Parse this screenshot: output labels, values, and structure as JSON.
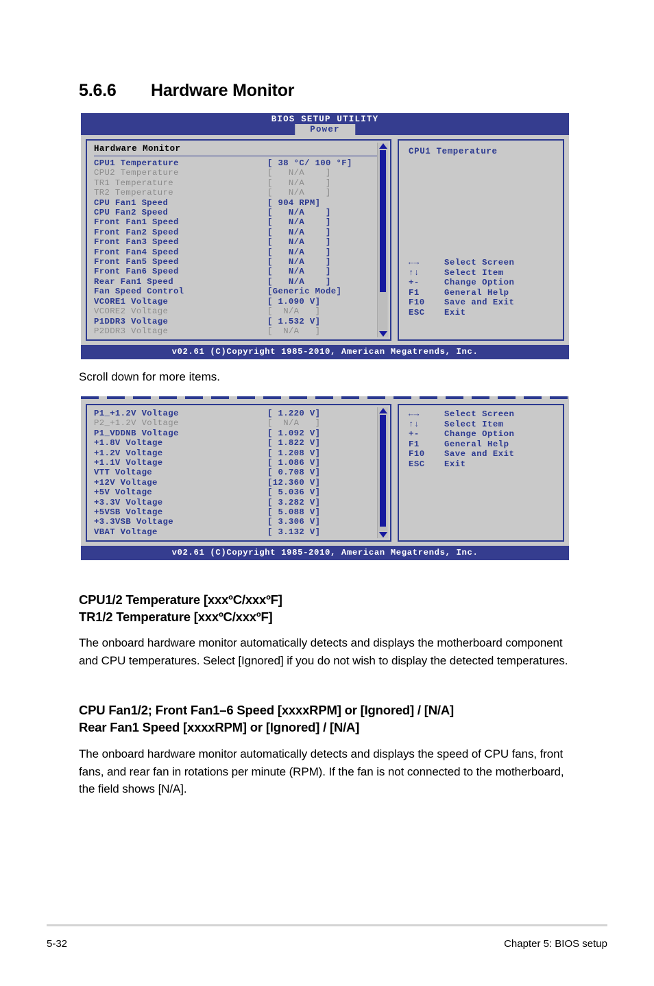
{
  "section": {
    "number": "5.6.6",
    "title": "Hardware Monitor"
  },
  "bios": {
    "utility_title": "BIOS SETUP UTILITY",
    "active_tab": "Power",
    "footer": "v02.61 (C)Copyright 1985-2010, American Megatrends, Inc.",
    "help_keys": [
      {
        "key": "←→",
        "action": "Select Screen"
      },
      {
        "key": "↑↓",
        "action": "Select Item"
      },
      {
        "key": "+-",
        "action": "Change Option"
      },
      {
        "key": "F1",
        "action": "General Help"
      },
      {
        "key": "F10",
        "action": "Save and Exit"
      },
      {
        "key": "ESC",
        "action": "Exit"
      }
    ]
  },
  "screen1": {
    "group_title": "Hardware Monitor",
    "help_item": "CPU1 Temperature",
    "items": [
      {
        "label": "CPU1 Temperature",
        "value": "[ 38 °C/ 100 °F]",
        "enabled": true
      },
      {
        "label": "CPU2 Temperature",
        "value": "[   N/A    ]",
        "enabled": false
      },
      {
        "label": "TR1 Temperature",
        "value": "[   N/A    ]",
        "enabled": false
      },
      {
        "label": "TR2 Temperature",
        "value": "[   N/A    ]",
        "enabled": false
      },
      {
        "label": "CPU Fan1 Speed",
        "value": "[ 904 RPM]",
        "enabled": true
      },
      {
        "label": "CPU Fan2 Speed",
        "value": "[   N/A    ]",
        "enabled": true
      },
      {
        "label": "Front Fan1 Speed",
        "value": "[   N/A    ]",
        "enabled": true
      },
      {
        "label": "Front Fan2 Speed",
        "value": "[   N/A    ]",
        "enabled": true
      },
      {
        "label": "Front Fan3 Speed",
        "value": "[   N/A    ]",
        "enabled": true
      },
      {
        "label": "Front Fan4 Speed",
        "value": "[   N/A    ]",
        "enabled": true
      },
      {
        "label": "Front Fan5 Speed",
        "value": "[   N/A    ]",
        "enabled": true
      },
      {
        "label": "Front Fan6 Speed",
        "value": "[   N/A    ]",
        "enabled": true
      },
      {
        "label": "Rear Fan1 Speed",
        "value": "[   N/A    ]",
        "enabled": true
      },
      {
        "label": "Fan Speed Control",
        "value": "[Generic Mode]",
        "enabled": true
      },
      {
        "label": "VCORE1 Voltage",
        "value": "[ 1.090 V]",
        "enabled": true
      },
      {
        "label": "VCORE2 Voltage",
        "value": "[  N/A   ]",
        "enabled": false
      },
      {
        "label": "P1DDR3 Voltage",
        "value": "[ 1.532 V]",
        "enabled": true
      },
      {
        "label": "P2DDR3 Voltage",
        "value": "[  N/A   ]",
        "enabled": false
      }
    ]
  },
  "scroll_note": "Scroll down for more items.",
  "screen2": {
    "items": [
      {
        "label": "P1_+1.2V Voltage",
        "value": "[ 1.220 V]",
        "enabled": true
      },
      {
        "label": "P2_+1.2V Voltage",
        "value": "[  N/A   ]",
        "enabled": false
      },
      {
        "label": "P1_VDDNB Voltage",
        "value": "[ 1.092 V]",
        "enabled": true
      },
      {
        "label": "+1.8V Voltage",
        "value": "[ 1.822 V]",
        "enabled": true
      },
      {
        "label": "+1.2V Voltage",
        "value": "[ 1.208 V]",
        "enabled": true
      },
      {
        "label": "+1.1V Voltage",
        "value": "[ 1.086 V]",
        "enabled": true
      },
      {
        "label": "VTT Voltage",
        "value": "[ 0.708 V]",
        "enabled": true
      },
      {
        "label": "+12V Voltage",
        "value": "[12.360 V]",
        "enabled": true
      },
      {
        "label": "+5V Voltage",
        "value": "[ 5.036 V]",
        "enabled": true
      },
      {
        "label": "+3.3V Voltage",
        "value": "[ 3.282 V]",
        "enabled": true
      },
      {
        "label": "+5VSB Voltage",
        "value": "[ 5.088 V]",
        "enabled": true
      },
      {
        "label": "+3.3VSB Voltage",
        "value": "[ 3.306 V]",
        "enabled": true
      },
      {
        "label": "VBAT Voltage",
        "value": "[ 3.132 V]",
        "enabled": true
      }
    ]
  },
  "doc": {
    "heading1_line1": "CPU1/2 Temperature [xxxºC/xxxºF]",
    "heading1_line2": "TR1/2 Temperature [xxxºC/xxxºF]",
    "para1": "The onboard hardware monitor automatically detects and displays the motherboard component and CPU temperatures. Select [Ignored] if you do not wish to display the detected temperatures.",
    "heading2_line1": "CPU Fan1/2; Front Fan1–6 Speed [xxxxRPM] or [Ignored] / [N/A]",
    "heading2_line2": "Rear Fan1 Speed [xxxxRPM] or [Ignored] / [N/A]",
    "para2": "The onboard hardware monitor automatically detects and displays the speed of CPU fans, front fans, and rear fan in rotations per minute (RPM). If the fan is not connected to the motherboard, the field shows [N/A]."
  },
  "page_footer": {
    "page_number": "5-32",
    "chapter": "Chapter 5: BIOS setup"
  },
  "colors": {
    "header_blue": "#353d8f",
    "text_blue": "#2b3990",
    "screen_bg": "#c9c9c9",
    "disabled_grey": "#8c8c8c"
  }
}
